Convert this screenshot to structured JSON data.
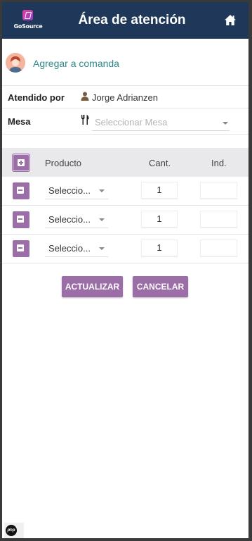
{
  "header": {
    "logo_text": "GoSource",
    "title": "Área de atención",
    "home_icon": "home-icon",
    "background": "#1f3859"
  },
  "add_command": {
    "label": "Agregar a comanda",
    "icon": "avatar"
  },
  "attended_by": {
    "label": "Atendido por",
    "icon": "user-icon",
    "value": "Jorge Adrianzen"
  },
  "table_field": {
    "label": "Mesa",
    "icon": "fork-knife-icon",
    "placeholder": "Seleccionar Mesa"
  },
  "items_table": {
    "columns": [
      "Producto",
      "Cant.",
      "Ind."
    ],
    "add_icon": "plus-square-icon",
    "remove_icon": "minus-square-icon",
    "rows": [
      {
        "product": "Seleccio...",
        "quantity": "1",
        "indication": ""
      },
      {
        "product": "Seleccio...",
        "quantity": "1",
        "indication": ""
      },
      {
        "product": "Seleccio...",
        "quantity": "1",
        "indication": ""
      }
    ]
  },
  "actions": {
    "update_label": "ACTUALIZAR",
    "cancel_label": "CANCELAR",
    "button_color": "#9c6ea7"
  },
  "footer": {
    "badge_text": "php"
  }
}
